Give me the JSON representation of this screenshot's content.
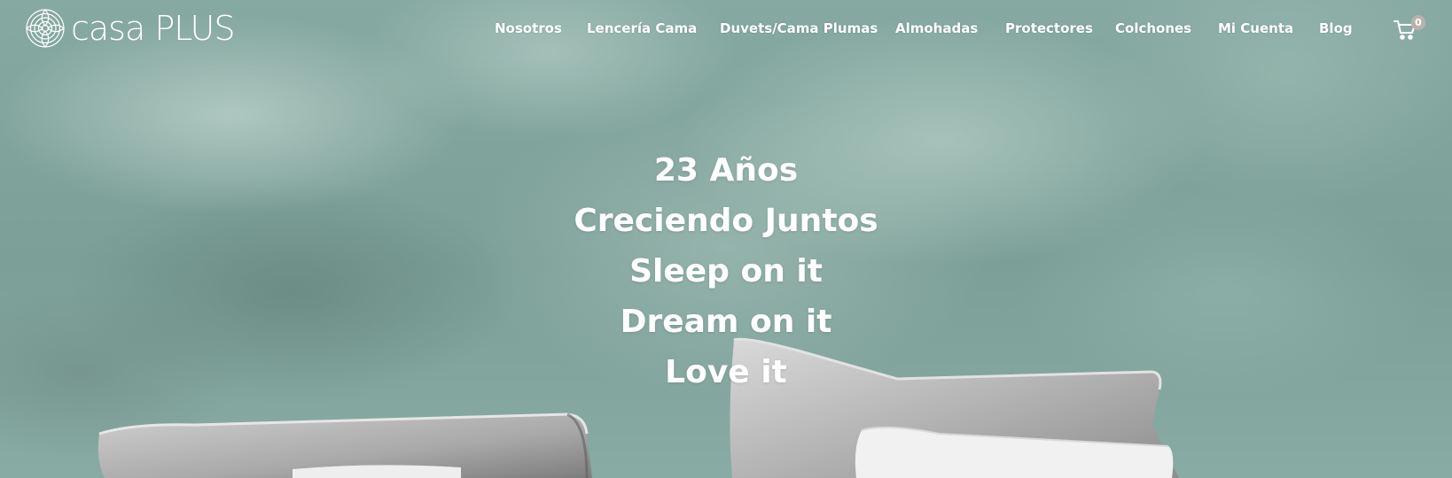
{
  "brand": {
    "logo_text": "casa PLUS"
  },
  "nav": {
    "items": [
      {
        "label": "Nosotros"
      },
      {
        "label": "Lencería Cama"
      },
      {
        "label": "Duvets/Cama Plumas"
      },
      {
        "label": "Almohadas"
      },
      {
        "label": "Protectores"
      },
      {
        "label": "Colchones"
      },
      {
        "label": "Mi Cuenta"
      },
      {
        "label": "Blog"
      }
    ]
  },
  "cart": {
    "icon": "cart-icon",
    "count": "0"
  },
  "hero": {
    "lines": [
      "23 Años",
      "Creciendo Juntos",
      "Sleep on it",
      "Dream on it",
      "Love it"
    ]
  },
  "colors": {
    "wall": "#7fa39b",
    "text": "#ffffff",
    "badge": "#b9b1ac",
    "pillow": "#c4c4c4"
  }
}
